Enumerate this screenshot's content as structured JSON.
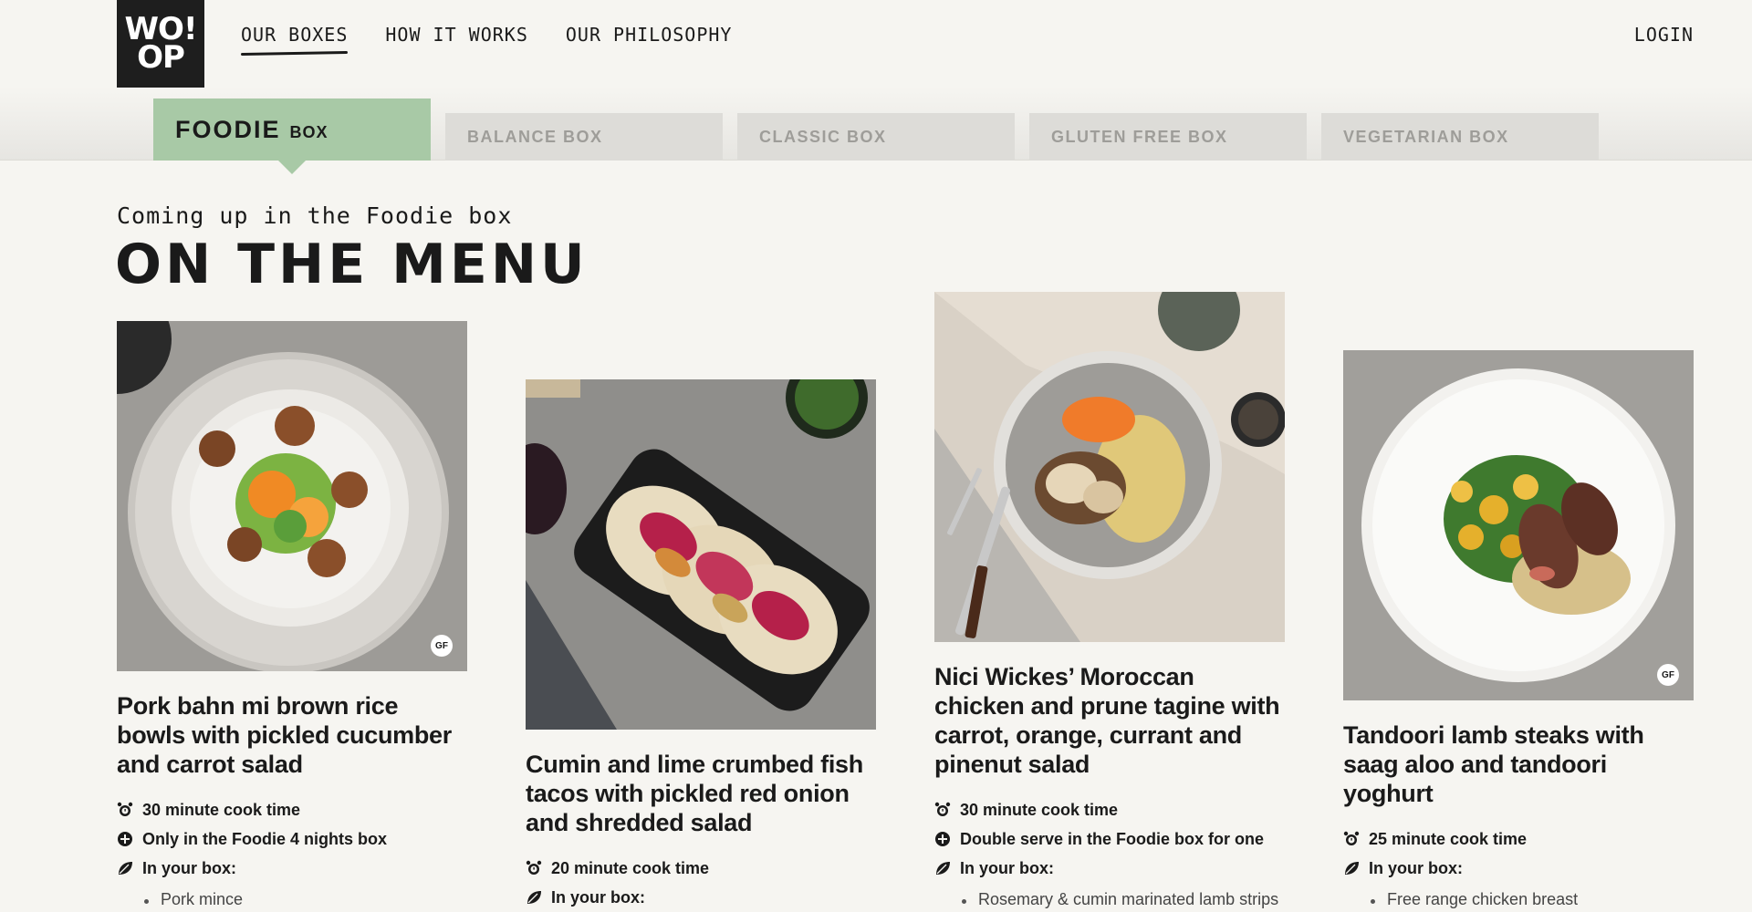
{
  "logo": {
    "line1": "WO!",
    "line2": "OP"
  },
  "nav": {
    "items": [
      "OUR BOXES",
      "HOW IT WORKS",
      "OUR PHILOSOPHY"
    ],
    "login": "LOGIN"
  },
  "tabs": {
    "active": {
      "label": "FOODIE",
      "sub": "BOX"
    },
    "others": [
      "BALANCE BOX",
      "CLASSIC BOX",
      "GLUTEN FREE BOX",
      "VEGETARIAN BOX"
    ]
  },
  "menu": {
    "subheading": "Coming up in the Foodie box",
    "heading": "ON THE MENU"
  },
  "cards": [
    {
      "title": "Pork bahn mi brown rice bowls with pickled cucumber and carrot salad",
      "badge": "GF",
      "meta": [
        "30 minute cook time",
        "Only in the Foodie 4 nights box",
        "In your box:"
      ],
      "ingredients": [
        "Pork mince"
      ]
    },
    {
      "title": "Cumin and lime crumbed fish tacos with pickled red onion and shredded salad",
      "badge": "",
      "meta": [
        "20 minute cook time",
        "In your box:"
      ],
      "ingredients": []
    },
    {
      "title": "Nici Wickes’ Moroccan chicken and prune tagine with carrot, orange, currant and pinenut salad",
      "badge": "",
      "meta": [
        "30 minute cook time",
        "Double serve in the Foodie box for one",
        "In your box:"
      ],
      "ingredients": [
        "Rosemary & cumin marinated lamb strips"
      ]
    },
    {
      "title": "Tandoori lamb steaks with saag aloo and tandoori yoghurt",
      "badge": "GF",
      "meta": [
        "25 minute cook time",
        "In your box:"
      ],
      "ingredients": [
        "Free range chicken breast"
      ]
    }
  ],
  "colors": {
    "background": "#f6f5f1",
    "activeTab": "#a8c9a6",
    "inactiveTab": "#dddcd8",
    "text": "#1a1a1a"
  }
}
